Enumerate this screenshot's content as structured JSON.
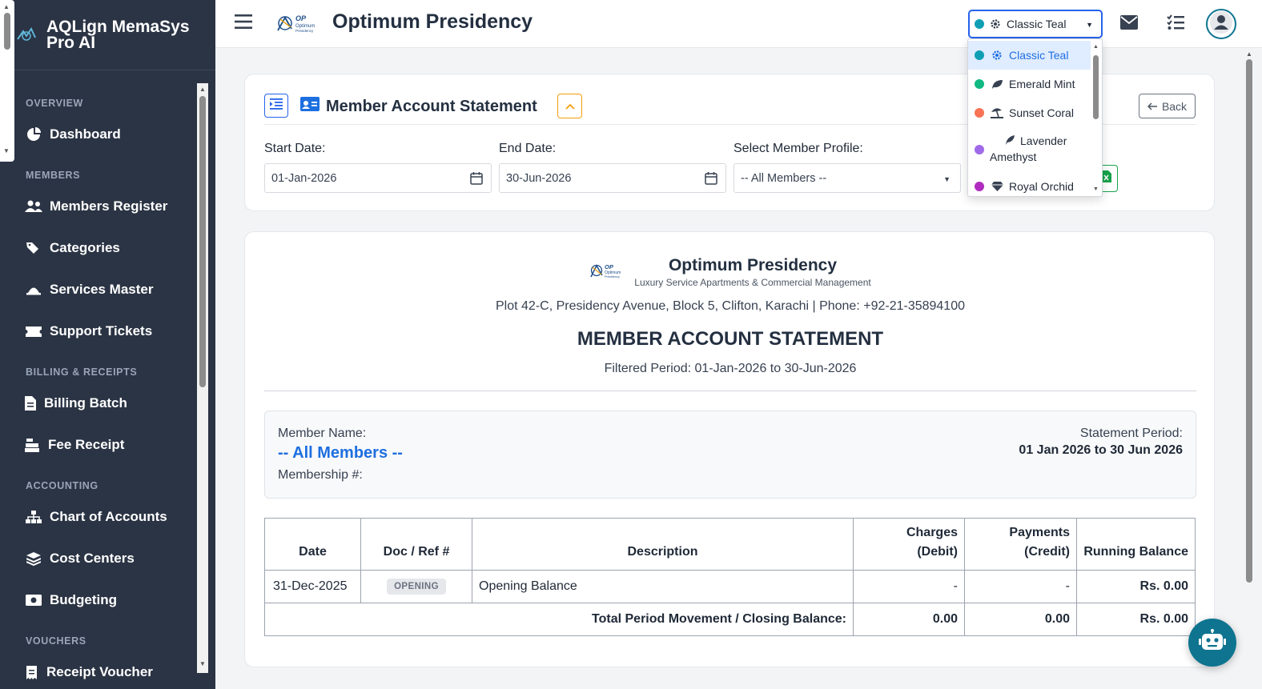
{
  "app": {
    "name": "AQLign MemaSys Pro AI",
    "header_title": "Optimum Presidency"
  },
  "sidebar": {
    "sections": [
      {
        "title": "OVERVIEW",
        "items": [
          {
            "label": "Dashboard",
            "icon": "chart-pie-icon"
          }
        ]
      },
      {
        "title": "MEMBERS",
        "items": [
          {
            "label": "Members Register",
            "icon": "users-icon"
          },
          {
            "label": "Categories",
            "icon": "tags-icon"
          },
          {
            "label": "Services Master",
            "icon": "bell-concierge-icon"
          },
          {
            "label": "Support Tickets",
            "icon": "ticket-icon"
          }
        ]
      },
      {
        "title": "BILLING & RECEIPTS",
        "items": [
          {
            "label": "Billing Batch",
            "icon": "file-invoice-icon"
          },
          {
            "label": "Fee Receipt",
            "icon": "cash-register-icon"
          }
        ]
      },
      {
        "title": "ACCOUNTING",
        "items": [
          {
            "label": "Chart of Accounts",
            "icon": "sitemap-icon"
          },
          {
            "label": "Cost Centers",
            "icon": "layer-group-icon"
          },
          {
            "label": "Budgeting",
            "icon": "money-bill-icon"
          }
        ]
      },
      {
        "title": "VOUCHERS",
        "items": [
          {
            "label": "Receipt Voucher",
            "icon": "receipt-icon"
          }
        ]
      }
    ]
  },
  "theme": {
    "selected": "Classic Teal",
    "options": [
      {
        "label": "Classic Teal",
        "color": "#0e9fb5",
        "icon": "gear-icon",
        "active": true
      },
      {
        "label": "Emerald Mint",
        "color": "#10b981",
        "icon": "leaf-icon"
      },
      {
        "label": "Sunset Coral",
        "color": "#f97354",
        "icon": "umbrella-beach-icon"
      },
      {
        "label": "Lavender Amethyst",
        "color": "#a06ae8",
        "icon": "feather-icon"
      },
      {
        "label": "Royal Orchid",
        "color": "#b02cc0",
        "icon": "gem-icon"
      }
    ]
  },
  "filter": {
    "title": "Member Account Statement",
    "back_label": "Back",
    "start_label": "Start Date:",
    "start_value": "01-Jan-2026",
    "end_label": "End Date:",
    "end_value": "30-Jun-2026",
    "member_label": "Select Member Profile:",
    "member_value": "-- All Members --"
  },
  "statement": {
    "company_name": "Optimum Presidency",
    "company_tagline": "Luxury Service Apartments & Commercial Management",
    "address": "Plot 42-C, Presidency Avenue, Block 5, Clifton, Karachi | Phone: +92-21-35894100",
    "doc_title": "MEMBER ACCOUNT STATEMENT",
    "period_text": "Filtered Period: 01-Jan-2026 to 30-Jun-2026",
    "member_name_label": "Member Name:",
    "member_name": "-- All Members --",
    "membership_label": "Membership #:",
    "statement_period_label": "Statement Period:",
    "statement_period_value": "01 Jan 2026 to 30 Jun 2026",
    "columns": {
      "date": "Date",
      "doc": "Doc / Ref #",
      "desc": "Description",
      "debit_1": "Charges",
      "debit_2": "(Debit)",
      "credit_1": "Payments",
      "credit_2": "(Credit)",
      "balance": "Running Balance"
    },
    "rows": [
      {
        "date": "31-Dec-2025",
        "doc": "OPENING",
        "desc": "Opening Balance",
        "debit": "-",
        "credit": "-",
        "balance": "Rs. 0.00"
      }
    ],
    "total": {
      "label": "Total Period Movement / Closing Balance:",
      "debit": "0.00",
      "credit": "0.00",
      "balance": "Rs. 0.00"
    }
  }
}
